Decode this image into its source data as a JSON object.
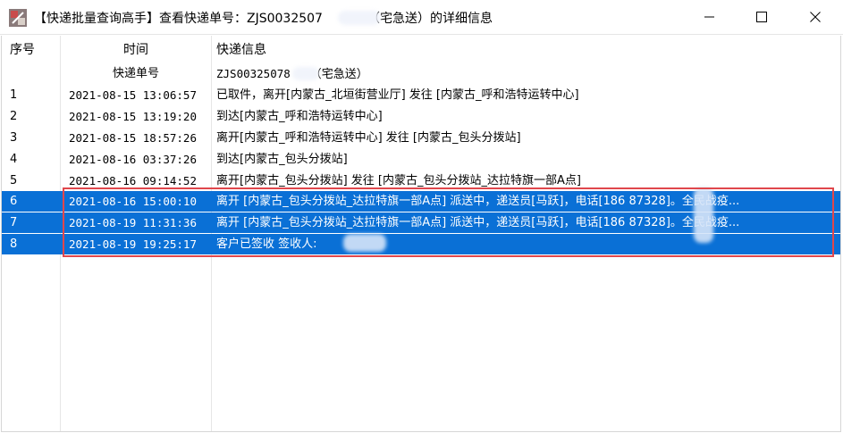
{
  "window": {
    "title": "【快递批量查询高手】查看快递单号：ZJS0032507",
    "title_suffix": "（宅急送）的详细信息"
  },
  "columns": {
    "seq": "序号",
    "time": "时间",
    "info": "快递信息"
  },
  "summary": {
    "label": "快递单号",
    "value": "ZJS00325078",
    "carrier": "（宅急送）"
  },
  "rows": [
    {
      "seq": "1",
      "time": "2021-08-15 13:06:57",
      "info": "已取件，离开[内蒙古_北垣街营业厅] 发往 [内蒙古_呼和浩特运转中心]",
      "selected": false
    },
    {
      "seq": "2",
      "time": "2021-08-15 13:19:20",
      "info": "到达[内蒙古_呼和浩特运转中心]",
      "selected": false
    },
    {
      "seq": "3",
      "time": "2021-08-15 18:57:26",
      "info": "离开[内蒙古_呼和浩特运转中心] 发往 [内蒙古_包头分拨站]",
      "selected": false
    },
    {
      "seq": "4",
      "time": "2021-08-16 03:37:26",
      "info": "到达[内蒙古_包头分拨站]",
      "selected": false
    },
    {
      "seq": "5",
      "time": "2021-08-16 09:14:52",
      "info": "离开[内蒙古_包头分拨站] 发往 [内蒙古_包头分拨站_达拉特旗一部A点]",
      "selected": false
    },
    {
      "seq": "6",
      "time": "2021-08-16 15:00:10",
      "info": "离开 [内蒙古_包头分拨站_达拉特旗一部A点] 派送中，递送员[马跃]，电话[186   87328]。全民战疫...",
      "selected": true
    },
    {
      "seq": "7",
      "time": "2021-08-19 11:31:36",
      "info": "离开 [内蒙古_包头分拨站_达拉特旗一部A点] 派送中，递送员[马跃]，电话[186   87328]。全民战疫...",
      "selected": true
    },
    {
      "seq": "8",
      "time": "2021-08-19 19:25:17",
      "info": "客户已签收 签收人:",
      "selected": true
    }
  ],
  "colors": {
    "selection": "#0a70d6",
    "highlight_border": "#e0474c"
  }
}
